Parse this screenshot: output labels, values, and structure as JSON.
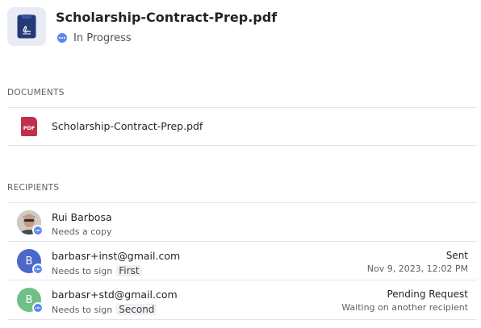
{
  "header": {
    "title": "Scholarship-Contract-Prep.pdf",
    "status": "In Progress",
    "icon": "contract-document-icon",
    "status_color": "#5b88e8"
  },
  "documents": {
    "heading": "DOCUMENTS",
    "items": [
      {
        "name": "Scholarship-Contract-Prep.pdf",
        "icon_label": "PDF",
        "icon_color": "#c0304b"
      }
    ]
  },
  "recipients": {
    "heading": "RECIPIENTS",
    "items": [
      {
        "name": "Rui Barbosa",
        "action": "Needs a copy",
        "order": "",
        "status": "",
        "sub": "",
        "avatar_initial": "",
        "avatar_color": ""
      },
      {
        "name": "barbasr+inst@gmail.com",
        "action": "Needs to sign",
        "order": "First",
        "status": "Sent",
        "sub": "Nov 9, 2023, 12:02 PM",
        "avatar_initial": "B",
        "avatar_color": "#4a67c9"
      },
      {
        "name": "barbasr+std@gmail.com",
        "action": "Needs to sign",
        "order": "Second",
        "status": "Pending Request",
        "sub": "Waiting on another recipient",
        "avatar_initial": "B",
        "avatar_color": "#6fbf86"
      }
    ]
  }
}
